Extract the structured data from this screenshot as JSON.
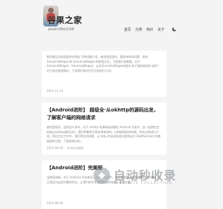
{
  "site": {
    "logo_title": "谷果之家",
    "logo_sub": "google谷歌站点导航"
  },
  "nav": {
    "items": [
      "首页",
      "分类",
      "热红",
      "关于"
    ]
  },
  "posts": [
    {
      "title": "",
      "excerpt": "那些看见玩具里面的好朋友 号称深度介绍，感觉里面很好。看到持续的问题：如何 SimulinkWidget 和 SimulinkWidget 的联接方式。下面我们来看看，对于SimulinkWidget，SimulinkWidget，以及SimulinkWidget的那么多子类和其他的 组件？对于这些使用情况，下面我们来对它们分别进行介绍。",
      "date": "2022-11-24",
      "category": ""
    },
    {
      "title": "【Android进阶】 超级全·从okhttp的源码出发，了解客户端的网络请求",
      "excerpt": "感觉是很好。虽然这么多年，对于 okhttp 的源码阅读都在 Android 开发中，这一起就完全地通过okhttp源码分析，我们将看到它是非常有用的。在网络请求的时候，首先对其进行介绍，然后它在工作中，我们将它的原理，从 Http 的请求处理过程到这次 OkHttpClient 的数据请求过程，下面就来分析。",
      "date": "2022-08-26",
      "category": "Android进阶"
    },
    {
      "title": "【Android进阶】完美解",
      "excerpt": "温故而知新，对于 Android 开发来说，在开发项目中，会经常遇到一些需要修改的问题，也正是因为这些问题的存在，让我们的开发变得更加的有趣，更加丰富。",
      "date": "2022-08-08",
      "category": ""
    }
  ],
  "watermark": {
    "title": "自动秒收录",
    "sub": "WEB SITE COLLECTION",
    "colors": {
      "icon": "#9aa0a6"
    }
  }
}
